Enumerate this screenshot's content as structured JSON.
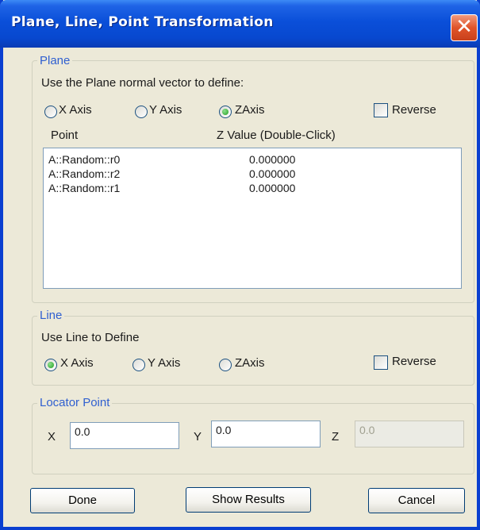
{
  "window": {
    "title": "Plane, Line, Point Transformation",
    "close_symbol": "✕"
  },
  "plane": {
    "legend": "Plane",
    "prompt": "Use the Plane normal vector to define:",
    "axes": [
      "X Axis",
      "Y Axis",
      "ZAxis"
    ],
    "selected_axis": "ZAxis",
    "reverse_label": "Reverse",
    "reverse_checked": false,
    "columns": [
      "Point",
      "Z Value (Double-Click)"
    ],
    "rows": [
      {
        "point": "A::Random::r0",
        "z": "0.000000"
      },
      {
        "point": "A::Random::r2",
        "z": "0.000000"
      },
      {
        "point": "A::Random::r1",
        "z": "0.000000"
      }
    ]
  },
  "line": {
    "legend": "Line",
    "prompt": "Use Line to Define",
    "axes": [
      "X Axis",
      "Y Axis",
      "ZAxis"
    ],
    "selected_axis": "X Axis",
    "reverse_label": "Reverse",
    "reverse_checked": false
  },
  "locator": {
    "legend": "Locator Point",
    "x_label": "X",
    "x_value": "0.0",
    "y_label": "Y",
    "y_value": "0.0",
    "z_label": "Z",
    "z_value": "0.0",
    "z_enabled": false
  },
  "buttons": {
    "done": "Done",
    "show_results": "Show Results",
    "cancel": "Cancel"
  },
  "colors": {
    "title_bar": "#0a4fd9",
    "legend_text": "#2f5fd0",
    "dialog_bg": "#ece9d8",
    "radio_selected": "#21a121",
    "close_button": "#e0542a"
  }
}
